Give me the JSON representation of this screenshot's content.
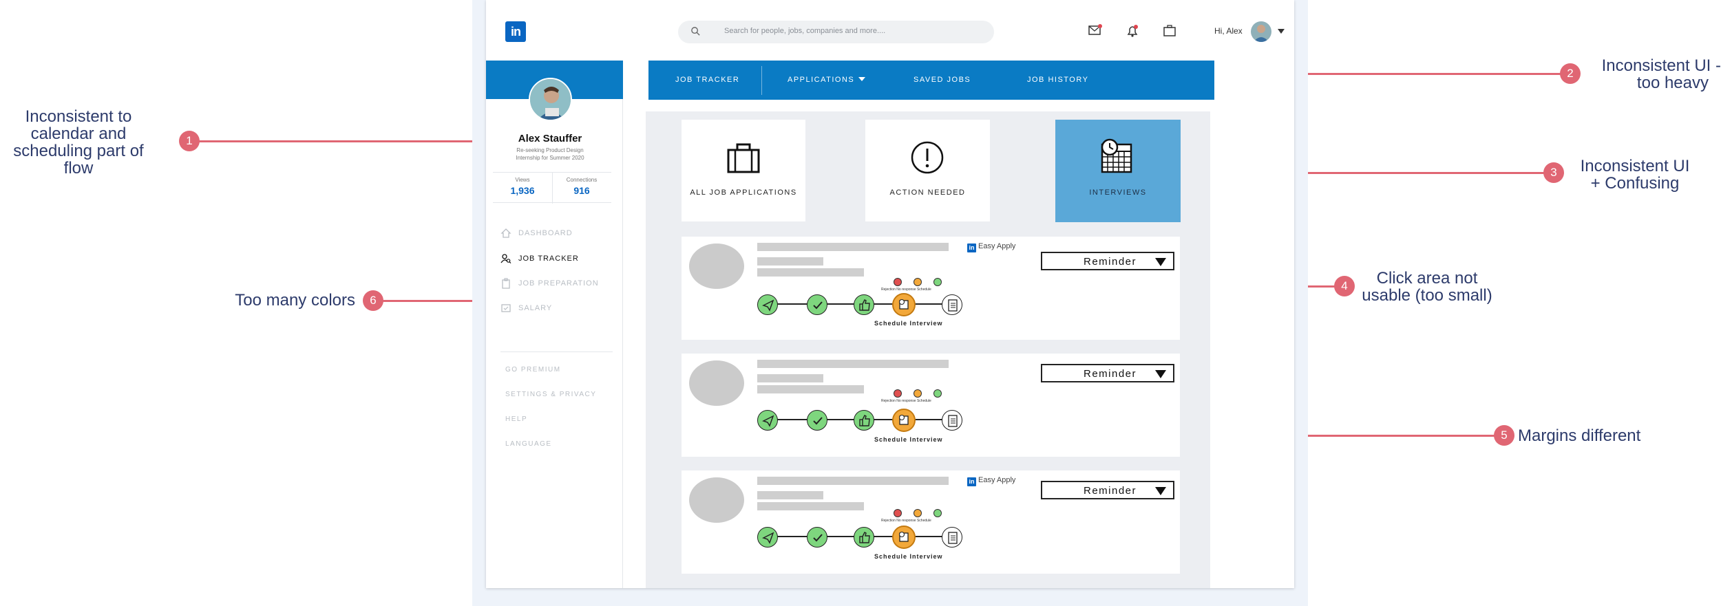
{
  "annotations": [
    {
      "number": "1",
      "text_lines": [
        "Inconsistent to",
        "calendar and",
        "scheduling part of",
        "flow"
      ]
    },
    {
      "number": "2",
      "text_lines": [
        "Inconsistent UI -",
        "too heavy"
      ]
    },
    {
      "number": "3",
      "text_lines": [
        "Inconsistent UI",
        "+ Confusing"
      ]
    },
    {
      "number": "4",
      "text_lines": [
        "Click area not",
        "usable (too small)"
      ]
    },
    {
      "number": "5",
      "text_lines": [
        "Margins different"
      ]
    },
    {
      "number": "6",
      "text_lines": [
        "Too many colors"
      ]
    }
  ],
  "topbar": {
    "logo": "in",
    "search_placeholder": "Search for people, jobs, companies and more....",
    "greeting": "Hi, Alex",
    "icons": [
      "messages-icon",
      "notifications-icon",
      "briefcase-icon"
    ]
  },
  "sidebar": {
    "name": "Alex Stauffer",
    "subtitle_lines": [
      "Re-seeking Product Design",
      "Internship for Summer 2020"
    ],
    "stats": [
      {
        "label": "Views",
        "value": "1,936"
      },
      {
        "label": "Connections",
        "value": "916"
      }
    ],
    "nav": [
      {
        "label": "DASHBOARD",
        "icon": "home-icon",
        "active": false
      },
      {
        "label": "JOB TRACKER",
        "icon": "user-search-icon",
        "active": true
      },
      {
        "label": "JOB PREPARATION",
        "icon": "clipboard-icon",
        "active": false
      },
      {
        "label": "SALARY",
        "icon": "money-icon",
        "active": false
      }
    ],
    "secondary": [
      "GO PREMIUM",
      "SETTINGS & PRIVACY",
      "HELP",
      "LANGUAGE"
    ]
  },
  "tabs": [
    {
      "label": "JOB TRACKER"
    },
    {
      "label": "APPLICATIONS"
    },
    {
      "label": "SAVED JOBS"
    },
    {
      "label": "JOB HISTORY"
    }
  ],
  "cards": [
    {
      "label": "ALL JOB APPLICATIONS",
      "icon": "briefcase-icon",
      "selected": false
    },
    {
      "label": "ACTION NEEDED",
      "icon": "exclamation-icon",
      "selected": false
    },
    {
      "label": "INTERVIEWS",
      "icon": "calendar-clock-icon",
      "selected": true
    }
  ],
  "jobs": [
    {
      "easy_apply": "Easy Apply",
      "reminder": "Reminder",
      "mini_labels": "Rejection No response Schedule",
      "schedule": "Schedule Interview"
    },
    {
      "easy_apply": "",
      "reminder": "Reminder",
      "mini_labels": "Rejection No response Schedule",
      "schedule": "Schedule Interview"
    },
    {
      "easy_apply": "Easy Apply",
      "reminder": "Reminder",
      "mini_labels": "Rejection No response Schedule",
      "schedule": "Schedule Interview"
    }
  ],
  "colors": {
    "brand_blue": "#0a7bc4",
    "selected_card": "#5aa8d8",
    "annotation": "#e06673",
    "annotation_text": "#2d3b6b",
    "step_green": "#7ed67e",
    "step_orange": "#f2a83a",
    "mini_red": "#e05050",
    "mini_orange": "#f2a83a",
    "mini_green": "#7ed67e"
  }
}
